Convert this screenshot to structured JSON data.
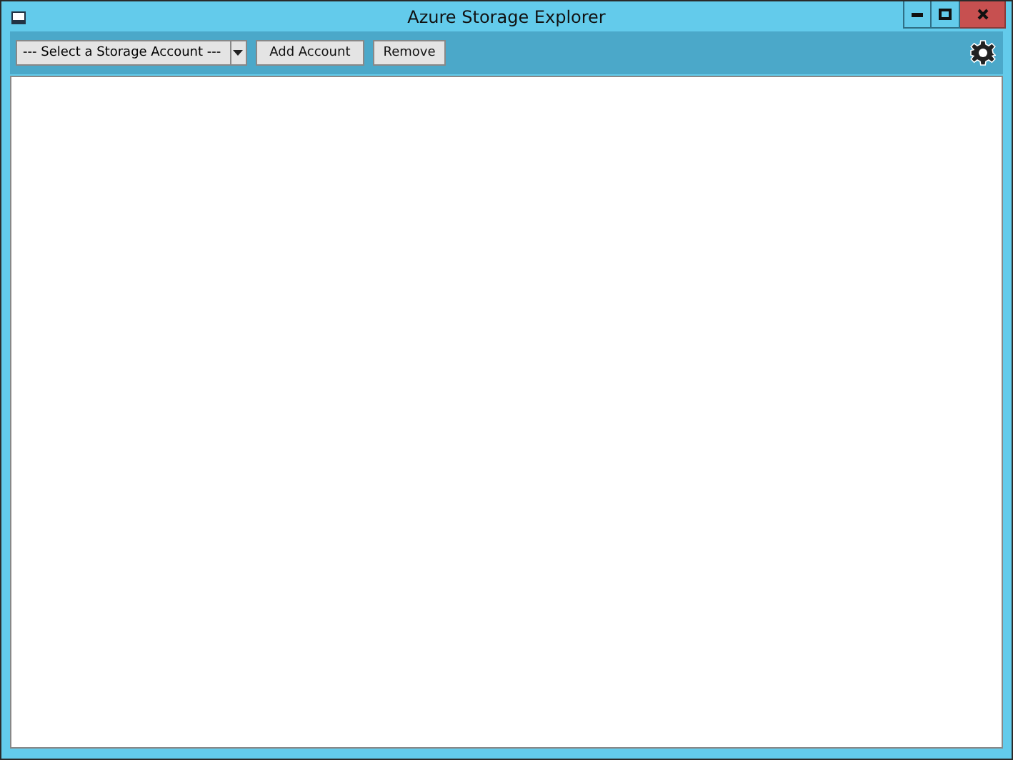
{
  "window": {
    "title": "Azure Storage Explorer"
  },
  "toolbar": {
    "account_select": {
      "text": "--- Select a Storage Account ---"
    },
    "buttons": [
      "Add Account",
      "Remove"
    ]
  }
}
